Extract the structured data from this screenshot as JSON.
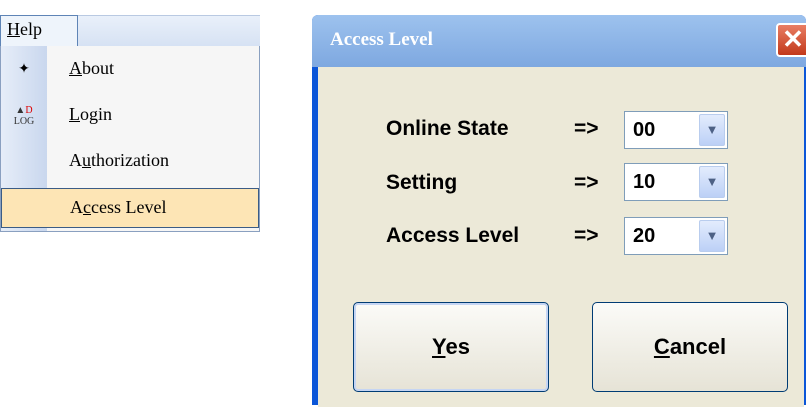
{
  "help_menu": {
    "title": "Help",
    "items": [
      {
        "label": "About",
        "icon": "about-icon",
        "accel_index": 0
      },
      {
        "label": "Login",
        "icon": "login-icon",
        "accel_index": 0
      },
      {
        "label": "Authorization",
        "icon": "",
        "accel_index": 1
      },
      {
        "label": "Access Level",
        "icon": "",
        "accel_index": 1,
        "selected": true
      }
    ]
  },
  "dialog": {
    "title": "Access  Level",
    "close_glyph": "✕",
    "rows": [
      {
        "label": "Online State",
        "arrow": "=>",
        "value": "00"
      },
      {
        "label": "Setting",
        "arrow": "=>",
        "value": "10"
      },
      {
        "label": "Access Level",
        "arrow": "=>",
        "value": "20"
      }
    ],
    "yes_label": "Yes",
    "cancel_label": "Cancel"
  },
  "colors": {
    "caption_red": "#ff0000",
    "selected_bg": "#fde5b5",
    "titlebar": "#8fb5e8"
  }
}
